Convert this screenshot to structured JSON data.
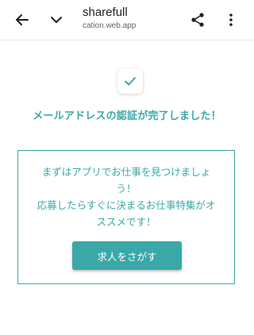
{
  "browser": {
    "title": "sharefull",
    "url": "cation.web.app"
  },
  "main": {
    "headline": "メールアドレスの認証が完了しました！",
    "message_line1": "まずはアプリでお仕事を見つけましょ",
    "message_line2": "う！",
    "message_line3": "応募したらすぐに決まるお仕事特集がオ",
    "message_line4": "ススメです！",
    "cta_label": "求人をさがす"
  },
  "colors": {
    "accent": "#3aa8a8"
  },
  "icons": {
    "back": "arrow-left-icon",
    "chevron": "chevron-down-icon",
    "share": "share-icon",
    "more": "more-vertical-icon",
    "success": "check-icon"
  }
}
